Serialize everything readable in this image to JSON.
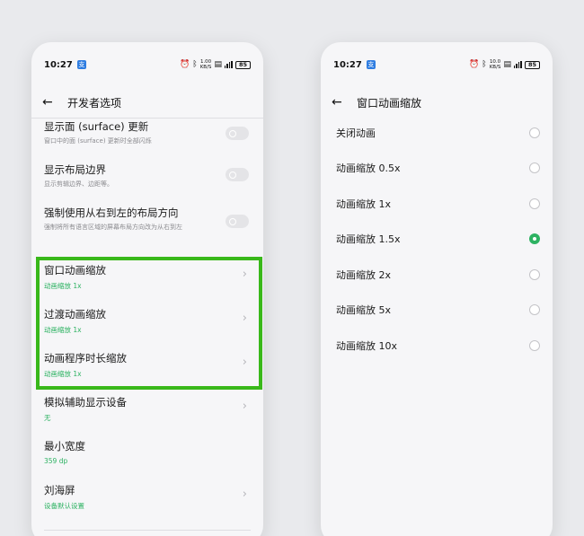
{
  "left_phone": {
    "status": {
      "time": "10:27",
      "app_badge": "支",
      "net_speed_value": "1.00",
      "net_speed_unit": "KB/S",
      "battery": "85"
    },
    "title": "开发者选项",
    "items": [
      {
        "title": "显示面 (surface) 更新",
        "desc": "窗口中的面 (surface) 更新时全部闪烁",
        "control": "toggle"
      },
      {
        "title": "显示布局边界",
        "desc": "显示剪辑边界、边距等。",
        "control": "toggle"
      },
      {
        "title": "强制使用从右到左的布局方向",
        "desc": "强制将所有语言区域的屏幕布局方向改为从右到左",
        "control": "toggle"
      },
      {
        "title": "窗口动画缩放",
        "value": "动画缩放 1x",
        "control": "chevron"
      },
      {
        "title": "过渡动画缩放",
        "value": "动画缩放 1x",
        "control": "chevron"
      },
      {
        "title": "动画程序时长缩放",
        "value": "动画缩放 1x",
        "control": "chevron"
      },
      {
        "title": "模拟辅助显示设备",
        "value": "无",
        "control": "chevron"
      },
      {
        "title": "最小宽度",
        "value": "359 dp",
        "control": "none"
      },
      {
        "title": "刘海屏",
        "value": "设备默认设置",
        "control": "chevron"
      }
    ]
  },
  "right_phone": {
    "status": {
      "time": "10:27",
      "app_badge": "支",
      "net_speed_value": "10.0",
      "net_speed_unit": "KB/S",
      "battery": "85"
    },
    "title": "窗口动画缩放",
    "options": [
      {
        "label": "关闭动画",
        "checked": false
      },
      {
        "label": "动画缩放 0.5x",
        "checked": false
      },
      {
        "label": "动画缩放 1x",
        "checked": false
      },
      {
        "label": "动画缩放 1.5x",
        "checked": true
      },
      {
        "label": "动画缩放 2x",
        "checked": false
      },
      {
        "label": "动画缩放 5x",
        "checked": false
      },
      {
        "label": "动画缩放 10x",
        "checked": false
      }
    ]
  },
  "colors": {
    "accent_green": "#2db262",
    "highlight_border": "#39b81a",
    "background": "#e9eaed"
  }
}
